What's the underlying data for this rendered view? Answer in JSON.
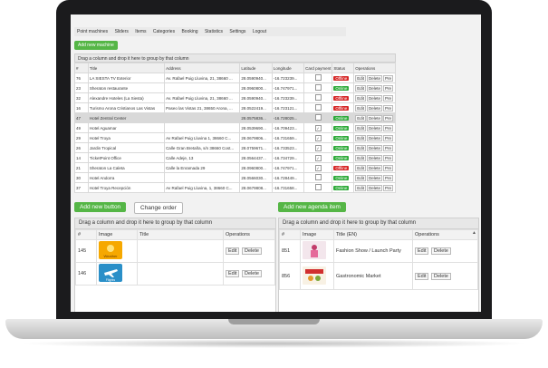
{
  "topnav": [
    "Point machines",
    "Sliders",
    "Items",
    "Categories",
    "Booking",
    "Statistics",
    "Settings",
    "Logout"
  ],
  "add_machine_label": "Add new machine",
  "group_hint": "Drag a column and drop it here to group by that column",
  "grid": {
    "headers": [
      "#",
      "Title",
      "Address",
      "Latitude",
      "Longitude",
      "Card payment",
      "Status",
      "Operations"
    ],
    "rows": [
      {
        "id": "76",
        "title": "LA SIESTA TV Exterior",
        "address": "Av. Rafael Puig Lluvina, 21, 38660 ...",
        "lat": "28.0590940...",
        "lng": "-16.723239...",
        "card": false,
        "status": "Offline"
      },
      {
        "id": "23",
        "title": "Sheraton restaurante",
        "address": "",
        "lat": "28.0960800...",
        "lng": "-16.747971...",
        "card": false,
        "status": "Online"
      },
      {
        "id": "32",
        "title": "Alexandre Hoteles (La Siesta)",
        "address": "Av. Rafael Puig Lluvina, 21, 38660 ...",
        "lat": "28.0590940...",
        "lng": "-16.723239...",
        "card": false,
        "status": "Offline"
      },
      {
        "id": "16",
        "title": "Turismo Arona Cristianos Las Vistas",
        "address": "Paseo las Vistas 21, 38650 Arona, ...",
        "lat": "28.0522419...",
        "lng": "-16.723121...",
        "card": false,
        "status": "Offline"
      },
      {
        "id": "47",
        "title": "Hotel Zentral Center",
        "address": "",
        "lat": "28.0575836...",
        "lng": "-16.728025...",
        "card": false,
        "status": "Online"
      },
      {
        "id": "49",
        "title": "Hotel Aguamar",
        "address": "",
        "lat": "28.0539690...",
        "lng": "-16.709423...",
        "card": true,
        "status": "Online"
      },
      {
        "id": "29",
        "title": "Hotel Troya",
        "address": "Av Rafael Puig Lluvina 1, 38660 C...",
        "lat": "28.0679806...",
        "lng": "-16.731659...",
        "card": true,
        "status": "Online"
      },
      {
        "id": "26",
        "title": "Jardin Tropical",
        "address": "Calle Gran Bretaña, s/n 38660 Cost...",
        "lat": "28.0759671...",
        "lng": "-16.733523...",
        "card": true,
        "status": "Online"
      },
      {
        "id": "14",
        "title": "TicketPoint Office",
        "address": "Calle Adeje, 13",
        "lat": "28.0564437...",
        "lng": "-16.734729...",
        "card": true,
        "status": "Online"
      },
      {
        "id": "21",
        "title": "Sheraton La Caleta",
        "address": "Calle la Enramada 29",
        "lat": "28.0960800...",
        "lng": "-16.747971...",
        "card": true,
        "status": "Offline"
      },
      {
        "id": "30",
        "title": "Hotel Andorra",
        "address": "",
        "lat": "28.0566030...",
        "lng": "-16.728449...",
        "card": false,
        "status": "Online"
      },
      {
        "id": "37",
        "title": "Hotel Troya Recepción",
        "address": "Av Rafael Puig Lluvina, 1, 38660 C...",
        "lat": "28.0679808...",
        "lng": "-16.731658...",
        "card": false,
        "status": "Online"
      }
    ],
    "op_labels": [
      "Edit",
      "Delete",
      "Pre"
    ]
  },
  "add_button_label": "Add new button",
  "change_order_label": "Change order",
  "add_agenda_label": "Add new agenda item",
  "left_panel": {
    "hint": "Drag a column and drop it here to group by that column",
    "headers": [
      "#",
      "Image",
      "Title",
      "Operations"
    ],
    "rows": [
      {
        "id": "145",
        "image": "Weather",
        "title": ""
      },
      {
        "id": "146",
        "image": "Flights",
        "title": ""
      }
    ]
  },
  "right_panel": {
    "hint": "Drag a column and drop it here to group by that column",
    "headers": [
      "#",
      "Image",
      "Title (EN)",
      "Operations"
    ],
    "rows": [
      {
        "id": "851",
        "title": "Fashion Show / Launch Party"
      },
      {
        "id": "856",
        "title": "Gastronomic Market"
      }
    ]
  },
  "edit_label": "Edit",
  "delete_label": "Delete",
  "colors": {
    "green": "#55b646",
    "online": "#2eaa3a",
    "offline": "#d62828"
  }
}
